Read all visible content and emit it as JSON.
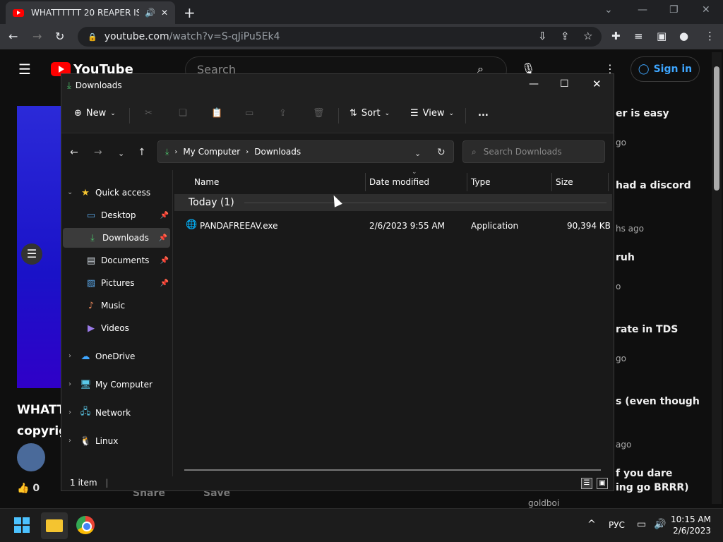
{
  "browser": {
    "tab_title": "WHATTTTTT 20 REAPER IS A",
    "url_host": "youtube.com",
    "url_path": "/watch?v=S-qJiPu5Ek4"
  },
  "youtube": {
    "logo_text": "YouTube",
    "search_placeholder": "Search",
    "signin_label": "Sign in",
    "video_title_line1": "WHATT",
    "video_title_line2": "copyrig",
    "like_count": "0",
    "share_label": "Share",
    "save_label": "Save",
    "sidebar": [
      {
        "title": "er is easy",
        "sub": "go"
      },
      {
        "title": "had a discord",
        "sub": "hs ago"
      },
      {
        "title": "ruh",
        "sub": "o"
      },
      {
        "title": "rate in TDS",
        "sub": "go"
      },
      {
        "title": "s (even though",
        "sub": "ago"
      },
      {
        "title": "f you dare",
        "sub": "ing go BRRR)"
      }
    ],
    "bottom_channel": "goldboi"
  },
  "explorer": {
    "title": "Downloads",
    "commands": {
      "new": "New",
      "sort": "Sort",
      "view": "View",
      "more": "..."
    },
    "breadcrumb": [
      "My Computer",
      "Downloads"
    ],
    "search_placeholder": "Search Downloads",
    "nav": {
      "quick_access": "Quick access",
      "items": [
        {
          "label": "Desktop",
          "icon": "desktop-icon",
          "pinned": true
        },
        {
          "label": "Downloads",
          "icon": "download-icon",
          "pinned": true,
          "selected": true
        },
        {
          "label": "Documents",
          "icon": "documents-icon",
          "pinned": true
        },
        {
          "label": "Pictures",
          "icon": "pictures-icon",
          "pinned": true
        },
        {
          "label": "Music",
          "icon": "music-icon",
          "pinned": false
        },
        {
          "label": "Videos",
          "icon": "videos-icon",
          "pinned": false
        }
      ],
      "roots": [
        "OneDrive",
        "My Computer",
        "Network",
        "Linux"
      ]
    },
    "columns": [
      "Name",
      "Date modified",
      "Type",
      "Size"
    ],
    "group_label": "Today (1)",
    "files": [
      {
        "name": "PANDAFREEAV.exe",
        "date": "2/6/2023 9:55 AM",
        "type": "Application",
        "size": "90,394 KB"
      }
    ],
    "status": "1 item"
  },
  "taskbar": {
    "lang": "РУС",
    "time": "10:15 AM",
    "date": "2/6/2023"
  }
}
